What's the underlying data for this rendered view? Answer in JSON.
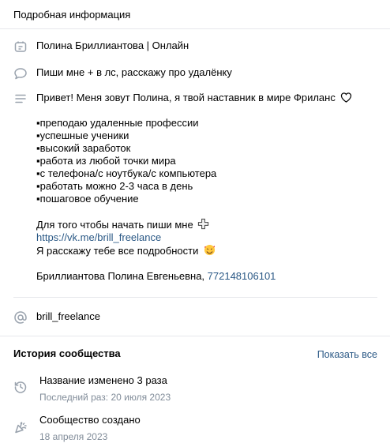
{
  "header": {
    "title": "Подробная информация"
  },
  "info": {
    "name_line": "Полина Бриллиантова | Онлайн",
    "status": "Пиши мне + в лс, расскажу про удалёнку",
    "description": {
      "intro": "Привет! Меня зовут Полина, я твой наставник в мире Фриланс",
      "bullets": [
        "▪преподаю удаленные профессии",
        "▪успешные ученики",
        "▪высокий заработок",
        "▪работа из любой точки мира",
        "▪с телефона/с ноутбука/с компьютера",
        "▪работать можно 2-3 часа в день",
        "▪пошаговое обучение"
      ],
      "cta": "Для того чтобы начать пиши мне",
      "link": "https://vk.me/brill_freelance",
      "promise": "Я расскажу тебе все подробности",
      "owner": "Бриллиантова Полина Евгеньевна, ",
      "inn": "772148106101"
    },
    "username": "brill_freelance"
  },
  "history": {
    "title": "История сообщества",
    "show_all": "Показать все",
    "items": [
      {
        "title": "Название изменено 3 раза",
        "subtitle": "Последний раз: 20 июля 2023",
        "icon": "history-icon"
      },
      {
        "title": "Сообщество создано",
        "subtitle": "18 апреля 2023",
        "icon": "party-popper-icon"
      }
    ]
  },
  "colors": {
    "link": "#2a5885",
    "icon": "#99a2ad",
    "muted": "#818c99",
    "divider": "#e7e8ec"
  }
}
